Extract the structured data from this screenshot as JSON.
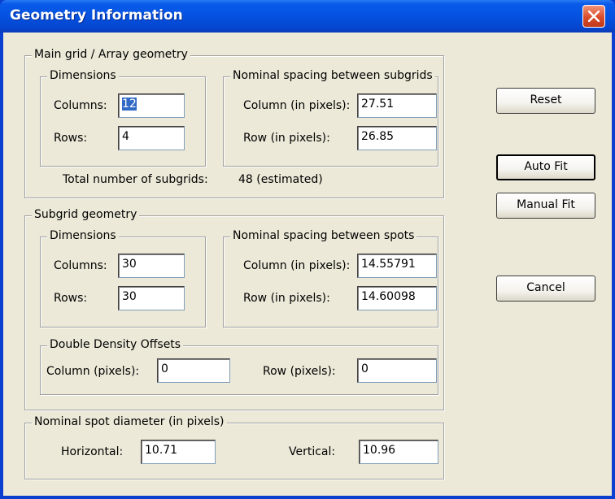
{
  "window": {
    "title": "Geometry Information"
  },
  "main_grid": {
    "legend": "Main grid / Array geometry",
    "dimensions": {
      "legend": "Dimensions",
      "columns_label": "Columns:",
      "columns_value": "12",
      "rows_label": "Rows:",
      "rows_value": "4"
    },
    "spacing": {
      "legend": "Nominal spacing between subgrids",
      "column_label": "Column (in pixels):",
      "column_value": "27.51",
      "row_label": "Row (in pixels):",
      "row_value": "26.85"
    },
    "total_label": "Total number of subgrids:",
    "total_value": "48 (estimated)"
  },
  "subgrid": {
    "legend": "Subgrid geometry",
    "dimensions": {
      "legend": "Dimensions",
      "columns_label": "Columns:",
      "columns_value": "30",
      "rows_label": "Rows:",
      "rows_value": "30"
    },
    "spacing": {
      "legend": "Nominal spacing between spots",
      "column_label": "Column (in pixels):",
      "column_value": "14.55791",
      "row_label": "Row (in pixels):",
      "row_value": "14.60098"
    },
    "double_density": {
      "legend": "Double Density Offsets",
      "column_label": "Column (pixels):",
      "column_value": "0",
      "row_label": "Row (pixels):",
      "row_value": "0"
    }
  },
  "spot_diameter": {
    "legend": "Nominal spot diameter (in pixels)",
    "horizontal_label": "Horizontal:",
    "horizontal_value": "10.71",
    "vertical_label": "Vertical:",
    "vertical_value": "10.96"
  },
  "buttons": {
    "reset": "Reset",
    "auto_fit": "Auto Fit",
    "manual_fit": "Manual Fit",
    "cancel": "Cancel"
  },
  "colors": {
    "titlebar": "#0552e0",
    "dialog_background": "#ece9d8",
    "selection": "#316ac5",
    "close_button": "#d94c2a"
  }
}
